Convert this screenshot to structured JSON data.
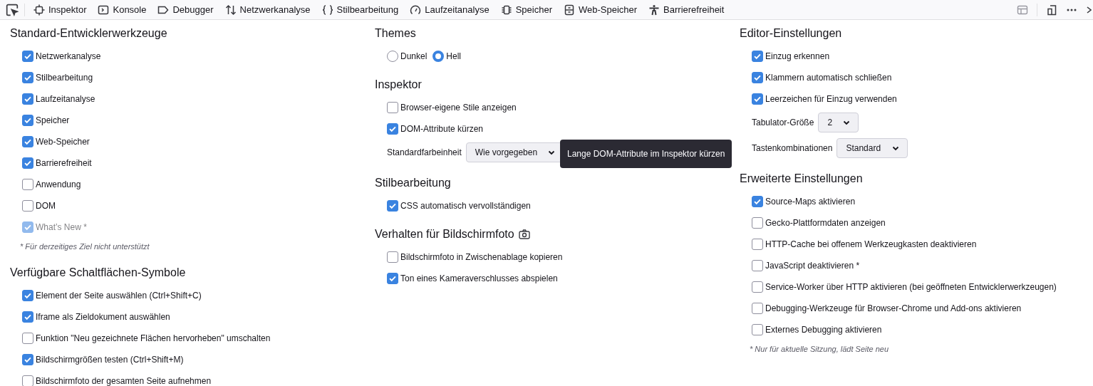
{
  "toolbar": {
    "tools": [
      {
        "label": "Inspektor"
      },
      {
        "label": "Konsole"
      },
      {
        "label": "Debugger"
      },
      {
        "label": "Netzwerkanalyse"
      },
      {
        "label": "Stilbearbeitung"
      },
      {
        "label": "Laufzeitanalyse"
      },
      {
        "label": "Speicher"
      },
      {
        "label": "Web-Speicher"
      },
      {
        "label": "Barrierefreiheit"
      }
    ]
  },
  "columns": [
    {
      "sections": [
        {
          "heading": "Standard-Entwicklerwerkzeuge",
          "items": [
            {
              "kind": "checkbox",
              "label": "Netzwerkanalyse",
              "checked": true,
              "disabled": false
            },
            {
              "kind": "checkbox",
              "label": "Stilbearbeitung",
              "checked": true,
              "disabled": false
            },
            {
              "kind": "checkbox",
              "label": "Laufzeitanalyse",
              "checked": true,
              "disabled": false
            },
            {
              "kind": "checkbox",
              "label": "Speicher",
              "checked": true,
              "disabled": false
            },
            {
              "kind": "checkbox",
              "label": "Web-Speicher",
              "checked": true,
              "disabled": false
            },
            {
              "kind": "checkbox",
              "label": "Barrierefreiheit",
              "checked": true,
              "disabled": false
            },
            {
              "kind": "checkbox",
              "label": "Anwendung",
              "checked": false,
              "disabled": false
            },
            {
              "kind": "checkbox",
              "label": "DOM",
              "checked": false,
              "disabled": false
            },
            {
              "kind": "checkbox",
              "label": "What’s New *",
              "checked": true,
              "disabled": true
            },
            {
              "kind": "note",
              "text": "* Für derzeitiges Ziel nicht unterstützt"
            }
          ]
        },
        {
          "heading": "Verfügbare Schaltflächen-Symbole",
          "items": [
            {
              "kind": "checkbox",
              "label": "Element der Seite auswählen (Ctrl+Shift+C)",
              "checked": true,
              "disabled": false
            },
            {
              "kind": "checkbox",
              "label": "Iframe als Zieldokument auswählen",
              "checked": true,
              "disabled": false
            },
            {
              "kind": "checkbox",
              "label": "Funktion \"Neu gezeichnete Flächen hervorheben\" umschalten",
              "checked": false,
              "disabled": false
            },
            {
              "kind": "checkbox",
              "label": "Bildschirmgrößen testen (Ctrl+Shift+M)",
              "checked": true,
              "disabled": false
            },
            {
              "kind": "checkbox",
              "label": "Bildschirmfoto der gesamten Seite aufnehmen",
              "checked": false,
              "disabled": false
            }
          ]
        }
      ]
    },
    {
      "sections": [
        {
          "heading": "Themes",
          "items": [
            {
              "kind": "radio",
              "options": [
                {
                  "label": "Dunkel",
                  "selected": false
                },
                {
                  "label": "Hell",
                  "selected": true
                }
              ]
            }
          ]
        },
        {
          "heading": "Inspektor",
          "items": [
            {
              "kind": "checkbox",
              "label": "Browser-eigene Stile anzeigen",
              "checked": false,
              "disabled": false
            },
            {
              "kind": "checkbox",
              "label": "DOM-Attribute kürzen",
              "checked": true,
              "disabled": false
            },
            {
              "kind": "select",
              "label": "Standardfarbeinheit",
              "value": "Wie vorgegeben"
            }
          ]
        },
        {
          "heading": "Stilbearbeitung",
          "items": [
            {
              "kind": "checkbox",
              "label": "CSS automatisch vervollständigen",
              "checked": true,
              "disabled": false
            }
          ]
        },
        {
          "heading": "Verhalten für Bildschirmfoto",
          "items": [
            {
              "kind": "checkbox",
              "label": "Bildschirmfoto in Zwischenablage kopieren",
              "checked": false,
              "disabled": false
            },
            {
              "kind": "checkbox",
              "label": "Ton eines Kameraverschlusses abspielen",
              "checked": true,
              "disabled": false
            }
          ]
        }
      ]
    },
    {
      "sections": [
        {
          "heading": "Editor-Einstellungen",
          "items": [
            {
              "kind": "checkbox",
              "label": "Einzug erkennen",
              "checked": true,
              "disabled": false
            },
            {
              "kind": "checkbox",
              "label": "Klammern automatisch schließen",
              "checked": true,
              "disabled": false
            },
            {
              "kind": "checkbox",
              "label": "Leerzeichen für Einzug verwenden",
              "checked": true,
              "disabled": false
            },
            {
              "kind": "select",
              "label": "Tabulator-Größe",
              "value": "2"
            },
            {
              "kind": "select",
              "label": "Tastenkombinationen",
              "value": "Standard"
            }
          ]
        },
        {
          "heading": "Erweiterte Einstellungen",
          "items": [
            {
              "kind": "checkbox",
              "label": "Source-Maps aktivieren",
              "checked": true,
              "disabled": false
            },
            {
              "kind": "checkbox",
              "label": "Gecko-Plattformdaten anzeigen",
              "checked": false,
              "disabled": false
            },
            {
              "kind": "checkbox",
              "label": "HTTP-Cache bei offenem Werkzeugkasten deaktivieren",
              "checked": false,
              "disabled": false
            },
            {
              "kind": "checkbox",
              "label": "JavaScript deaktivieren *",
              "checked": false,
              "disabled": false
            },
            {
              "kind": "checkbox",
              "label": "Service-Worker über HTTP aktivieren (bei geöffneten Entwicklerwerkzeugen)",
              "checked": false,
              "disabled": false
            },
            {
              "kind": "checkbox",
              "label": "Debugging-Werkzeuge für Browser-Chrome und Add-ons aktivieren",
              "checked": false,
              "disabled": false
            },
            {
              "kind": "checkbox",
              "label": "Externes Debugging aktivieren",
              "checked": false,
              "disabled": false
            },
            {
              "kind": "note",
              "text": "* Nur für aktuelle Sitzung, lädt Seite neu"
            }
          ]
        }
      ]
    }
  ],
  "tooltip": {
    "text": "Lange DOM-Attribute im Inspektor kürzen"
  }
}
